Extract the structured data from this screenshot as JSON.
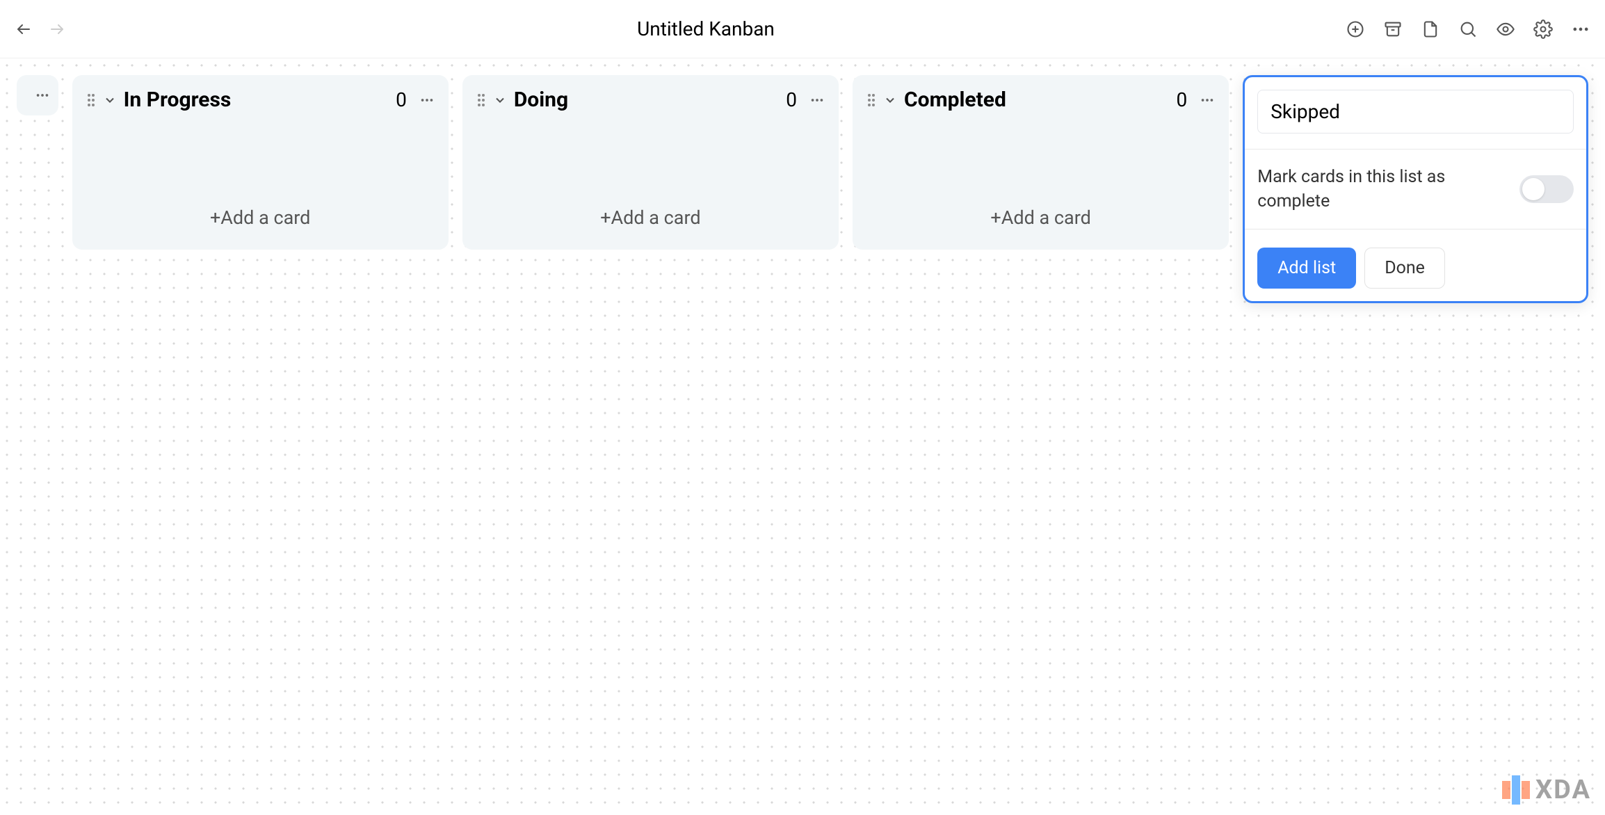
{
  "header": {
    "title": "Untitled Kanban"
  },
  "lists": [
    {
      "title": "In Progress",
      "count": "0",
      "add_card_label": "+Add a card"
    },
    {
      "title": "Doing",
      "count": "0",
      "add_card_label": "+Add a card"
    },
    {
      "title": "Completed",
      "count": "0",
      "add_card_label": "+Add a card"
    }
  ],
  "new_list": {
    "input_value": "Skipped",
    "toggle_label": "Mark cards in this list as complete",
    "add_button": "Add list",
    "done_button": "Done"
  },
  "watermark": {
    "text": "XDA"
  }
}
